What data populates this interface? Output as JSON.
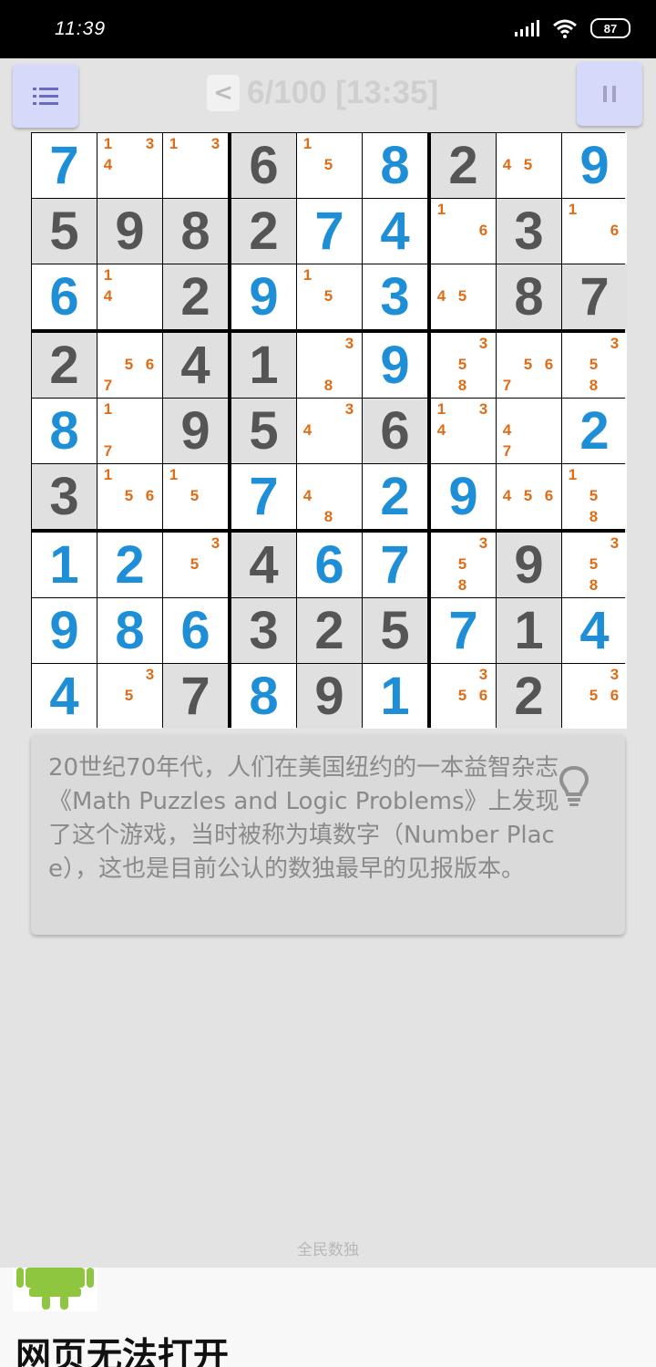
{
  "status_bar": {
    "time": "11:39",
    "battery": "87"
  },
  "header": {
    "title": "6/100 [13:35]",
    "back_label": "<"
  },
  "colors": {
    "given": "#555555",
    "user": "#1e8fd6",
    "note": "#e06c16",
    "button_bg": "#d7d9fb"
  },
  "board": {
    "rows": [
      [
        {
          "v": 7,
          "t": "user",
          "bg": "white"
        },
        {
          "notes": [
            1,
            3,
            4
          ],
          "bg": "white"
        },
        {
          "notes": [
            1,
            3
          ],
          "bg": "white"
        },
        {
          "v": 6,
          "t": "given",
          "bg": "grey"
        },
        {
          "notes": [
            1,
            5
          ],
          "bg": "white"
        },
        {
          "v": 8,
          "t": "user",
          "bg": "white"
        },
        {
          "v": 2,
          "t": "given",
          "bg": "grey"
        },
        {
          "notes": [
            4,
            5
          ],
          "bg": "white"
        },
        {
          "v": 9,
          "t": "user",
          "bg": "white"
        }
      ],
      [
        {
          "v": 5,
          "t": "given",
          "bg": "grey"
        },
        {
          "v": 9,
          "t": "given",
          "bg": "grey"
        },
        {
          "v": 8,
          "t": "given",
          "bg": "grey"
        },
        {
          "v": 2,
          "t": "given",
          "bg": "grey"
        },
        {
          "v": 7,
          "t": "user",
          "bg": "white"
        },
        {
          "v": 4,
          "t": "user",
          "bg": "white"
        },
        {
          "notes": [
            1,
            6
          ],
          "bg": "white"
        },
        {
          "v": 3,
          "t": "given",
          "bg": "grey"
        },
        {
          "notes": [
            1,
            6
          ],
          "bg": "white"
        }
      ],
      [
        {
          "v": 6,
          "t": "user",
          "bg": "white"
        },
        {
          "notes": [
            1,
            4
          ],
          "bg": "white"
        },
        {
          "v": 2,
          "t": "given",
          "bg": "grey"
        },
        {
          "v": 9,
          "t": "user",
          "bg": "white"
        },
        {
          "notes": [
            1,
            5
          ],
          "bg": "white"
        },
        {
          "v": 3,
          "t": "user",
          "bg": "white"
        },
        {
          "notes": [
            4,
            5
          ],
          "bg": "white"
        },
        {
          "v": 8,
          "t": "given",
          "bg": "grey"
        },
        {
          "v": 7,
          "t": "given",
          "bg": "grey"
        }
      ],
      [
        {
          "v": 2,
          "t": "given",
          "bg": "grey"
        },
        {
          "notes": [
            5,
            6,
            7
          ],
          "bg": "white"
        },
        {
          "v": 4,
          "t": "given",
          "bg": "grey"
        },
        {
          "v": 1,
          "t": "given",
          "bg": "grey"
        },
        {
          "notes": [
            3,
            8
          ],
          "bg": "white"
        },
        {
          "v": 9,
          "t": "user",
          "bg": "white"
        },
        {
          "notes": [
            3,
            5,
            8
          ],
          "bg": "white"
        },
        {
          "notes": [
            5,
            6,
            7
          ],
          "bg": "white"
        },
        {
          "notes": [
            3,
            5,
            8
          ],
          "bg": "white"
        }
      ],
      [
        {
          "v": 8,
          "t": "user",
          "bg": "white"
        },
        {
          "notes": [
            1,
            7
          ],
          "bg": "white"
        },
        {
          "v": 9,
          "t": "given",
          "bg": "grey"
        },
        {
          "v": 5,
          "t": "given",
          "bg": "grey"
        },
        {
          "notes": [
            3,
            4
          ],
          "bg": "white"
        },
        {
          "v": 6,
          "t": "given",
          "bg": "grey"
        },
        {
          "notes": [
            1,
            3,
            4
          ],
          "bg": "white"
        },
        {
          "notes": [
            4,
            7
          ],
          "bg": "white"
        },
        {
          "v": 2,
          "t": "user",
          "bg": "white"
        }
      ],
      [
        {
          "v": 3,
          "t": "given",
          "bg": "grey"
        },
        {
          "notes": [
            1,
            5,
            6
          ],
          "bg": "white"
        },
        {
          "notes": [
            1,
            5
          ],
          "bg": "white"
        },
        {
          "v": 7,
          "t": "user",
          "bg": "white"
        },
        {
          "notes": [
            4,
            8
          ],
          "bg": "white"
        },
        {
          "v": 2,
          "t": "user",
          "bg": "white"
        },
        {
          "v": 9,
          "t": "user",
          "bg": "white"
        },
        {
          "notes": [
            4,
            5,
            6
          ],
          "bg": "white"
        },
        {
          "notes": [
            1,
            5,
            8
          ],
          "bg": "white"
        }
      ],
      [
        {
          "v": 1,
          "t": "user",
          "bg": "white"
        },
        {
          "v": 2,
          "t": "user",
          "bg": "white"
        },
        {
          "notes": [
            3,
            5
          ],
          "bg": "white"
        },
        {
          "v": 4,
          "t": "given",
          "bg": "grey"
        },
        {
          "v": 6,
          "t": "user",
          "bg": "white"
        },
        {
          "v": 7,
          "t": "user",
          "bg": "white"
        },
        {
          "notes": [
            3,
            5,
            8
          ],
          "bg": "white"
        },
        {
          "v": 9,
          "t": "given",
          "bg": "grey"
        },
        {
          "notes": [
            3,
            5,
            8
          ],
          "bg": "white"
        }
      ],
      [
        {
          "v": 9,
          "t": "user",
          "bg": "white"
        },
        {
          "v": 8,
          "t": "user",
          "bg": "white"
        },
        {
          "v": 6,
          "t": "user",
          "bg": "white"
        },
        {
          "v": 3,
          "t": "given",
          "bg": "grey"
        },
        {
          "v": 2,
          "t": "given",
          "bg": "grey"
        },
        {
          "v": 5,
          "t": "given",
          "bg": "grey"
        },
        {
          "v": 7,
          "t": "user",
          "bg": "white"
        },
        {
          "v": 1,
          "t": "given",
          "bg": "grey"
        },
        {
          "v": 4,
          "t": "user",
          "bg": "white"
        }
      ],
      [
        {
          "v": 4,
          "t": "user",
          "bg": "white"
        },
        {
          "notes": [
            3,
            5
          ],
          "bg": "white"
        },
        {
          "v": 7,
          "t": "given",
          "bg": "grey"
        },
        {
          "v": 8,
          "t": "user",
          "bg": "white"
        },
        {
          "v": 9,
          "t": "given",
          "bg": "grey"
        },
        {
          "v": 1,
          "t": "user",
          "bg": "white"
        },
        {
          "notes": [
            3,
            5,
            6
          ],
          "bg": "white"
        },
        {
          "v": 2,
          "t": "given",
          "bg": "grey"
        },
        {
          "notes": [
            3,
            5,
            6
          ],
          "bg": "white"
        }
      ]
    ]
  },
  "hint": {
    "text": "20世纪70年代，人们在美国纽约的一本益智杂志《Math Puzzles and Logic Problems》上发现了这个游戏，当时被称为填数字（Number Place），这也是目前公认的数独最早的见报版本。",
    "icon": "lightbulb-icon"
  },
  "footer": {
    "app_name": "全民数独"
  },
  "ad": {
    "title": "网页无法打开"
  }
}
